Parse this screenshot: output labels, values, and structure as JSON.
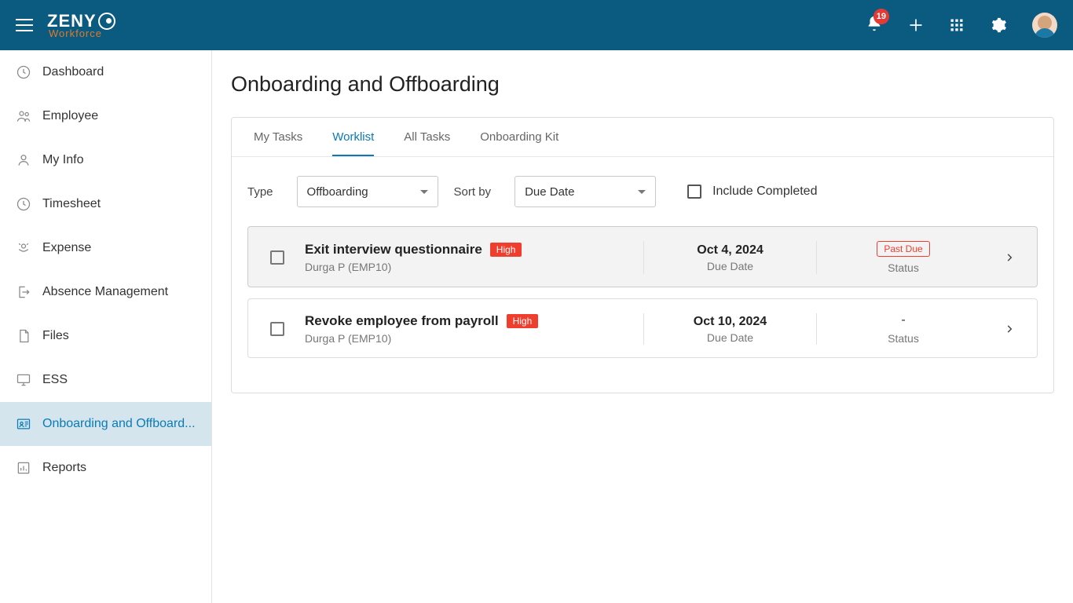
{
  "header": {
    "logo_main": "ZENY",
    "logo_sub": "Workforce",
    "notifications": "19"
  },
  "sidebar": {
    "items": [
      {
        "label": "Dashboard"
      },
      {
        "label": "Employee"
      },
      {
        "label": "My Info"
      },
      {
        "label": "Timesheet"
      },
      {
        "label": "Expense"
      },
      {
        "label": "Absence Management"
      },
      {
        "label": "Files"
      },
      {
        "label": "ESS"
      },
      {
        "label": "Onboarding and Offboard..."
      },
      {
        "label": "Reports"
      }
    ]
  },
  "page": {
    "title": "Onboarding and Offboarding",
    "tabs": [
      "My Tasks",
      "Worklist",
      "All Tasks",
      "Onboarding Kit"
    ],
    "filters": {
      "type_label": "Type",
      "type_value": "Offboarding",
      "sort_label": "Sort by",
      "sort_value": "Due Date",
      "include_completed": "Include Completed"
    },
    "tasks": [
      {
        "title": "Exit interview questionnaire",
        "priority": "High",
        "assignee": "Durga P (EMP10)",
        "date": "Oct 4, 2024",
        "date_label": "Due Date",
        "status": "Past Due",
        "status_label": "Status"
      },
      {
        "title": "Revoke employee from payroll",
        "priority": "High",
        "assignee": "Durga P (EMP10)",
        "date": "Oct 10, 2024",
        "date_label": "Due Date",
        "status": "-",
        "status_label": "Status"
      }
    ]
  }
}
